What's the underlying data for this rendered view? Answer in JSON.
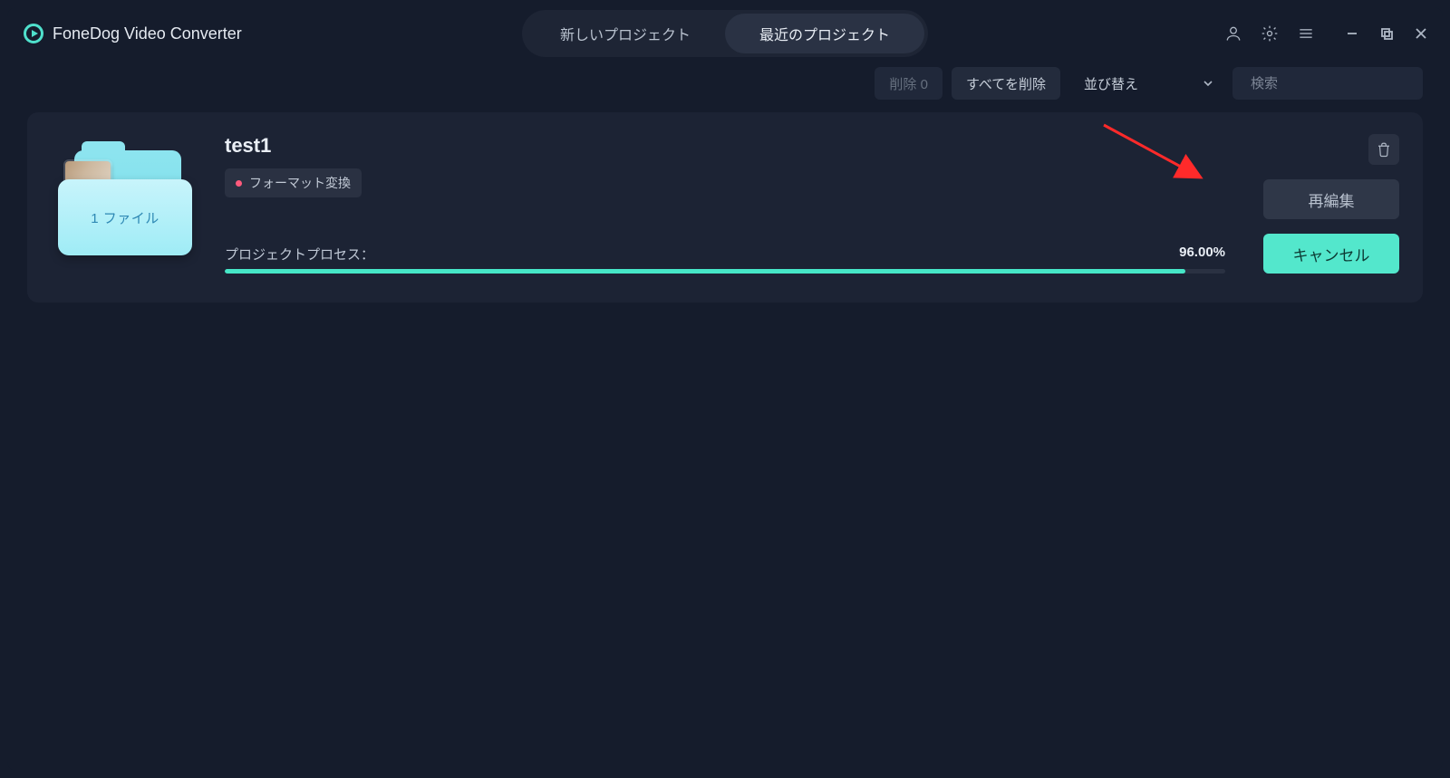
{
  "app": {
    "title": "FoneDog Video Converter"
  },
  "tabs": {
    "newProject": "新しいプロジェクト",
    "recentProjects": "最近のプロジェクト"
  },
  "toolbar": {
    "delete": "削除 0",
    "deleteAll": "すべてを削除",
    "sort": "並び替え",
    "searchPlaceholder": "検索"
  },
  "project": {
    "name": "test1",
    "filesLabel": "1 ファイル",
    "badge": "フォーマット変換",
    "processLabel": "プロジェクトプロセス：",
    "progressPercent": 96.0,
    "progressText": "96.00%",
    "reEdit": "再編集",
    "cancel": "キャンセル"
  }
}
